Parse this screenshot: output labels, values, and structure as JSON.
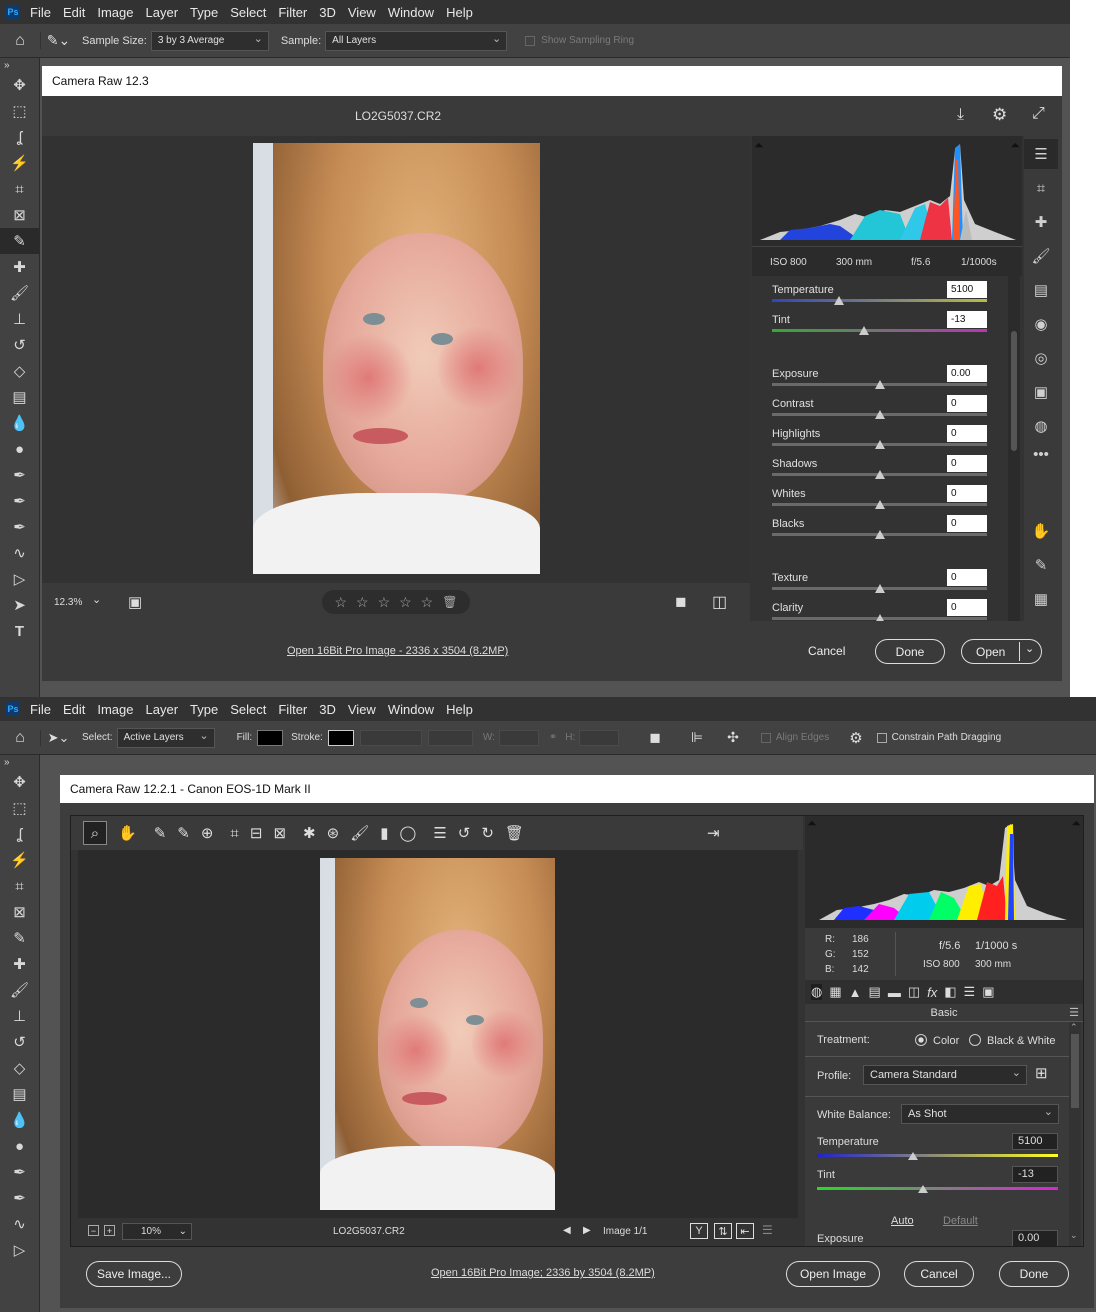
{
  "menu": [
    "File",
    "Edit",
    "Image",
    "Layer",
    "Type",
    "Select",
    "Filter",
    "3D",
    "View",
    "Window",
    "Help"
  ],
  "top": {
    "options": {
      "sample_size_label": "Sample Size:",
      "sample_size_value": "3 by 3 Average",
      "sample_label": "Sample:",
      "sample_value": "All Layers",
      "show_ring": "Show Sampling Ring"
    },
    "dialog_title": "Camera Raw 12.3",
    "filename": "LO2G5037.CR2",
    "meta": {
      "iso": "ISO 800",
      "focal": "300 mm",
      "aperture": "f/5.6",
      "shutter": "1/1000s"
    },
    "sliders": [
      {
        "label": "Temperature",
        "value": "5100",
        "pos": 0.31
      },
      {
        "label": "Tint",
        "value": "-13",
        "pos": 0.43
      },
      {
        "label": "Exposure",
        "value": "0.00",
        "pos": 0.5
      },
      {
        "label": "Contrast",
        "value": "0",
        "pos": 0.5
      },
      {
        "label": "Highlights",
        "value": "0",
        "pos": 0.5
      },
      {
        "label": "Shadows",
        "value": "0",
        "pos": 0.5
      },
      {
        "label": "Whites",
        "value": "0",
        "pos": 0.5
      },
      {
        "label": "Blacks",
        "value": "0",
        "pos": 0.5
      },
      {
        "label": "Texture",
        "value": "0",
        "pos": 0.5
      },
      {
        "label": "Clarity",
        "value": "0",
        "pos": 0.5
      }
    ],
    "zoom": "12.3%",
    "workflow_link": "Open 16Bit Pro Image - 2336 x 3504 (8.2MP)",
    "cancel": "Cancel",
    "done": "Done",
    "open": "Open"
  },
  "bottom": {
    "options": {
      "select_label": "Select:",
      "select_value": "Active Layers",
      "fill_label": "Fill:",
      "stroke_label": "Stroke:",
      "w_label": "W:",
      "h_label": "H:",
      "align_edges": "Align Edges",
      "constrain": "Constrain Path Dragging"
    },
    "dialog_title": "Camera Raw 12.2.1  -  Canon EOS-1D Mark II",
    "rgb": {
      "r_label": "R:",
      "r": "186",
      "g_label": "G:",
      "g": "152",
      "b_label": "B:",
      "b": "142"
    },
    "meta": {
      "aperture": "f/5.6",
      "shutter": "1/1000 s",
      "iso": "ISO 800",
      "focal": "300 mm"
    },
    "panel_title": "Basic",
    "treatment_label": "Treatment:",
    "color": "Color",
    "bw": "Black & White",
    "profile_label": "Profile:",
    "profile_value": "Camera Standard",
    "wb_label": "White Balance:",
    "wb_value": "As Shot",
    "temp_label": "Temperature",
    "temp_value": "5100",
    "temp_pos": 0.4,
    "tint_label": "Tint",
    "tint_value": "-13",
    "tint_pos": 0.44,
    "auto": "Auto",
    "default": "Default",
    "exposure_label": "Exposure",
    "exposure_value": "0.00",
    "zoom": "10%",
    "filename": "LO2G5037.CR2",
    "image_count": "Image 1/1",
    "save": "Save Image...",
    "workflow_link": "Open 16Bit Pro Image; 2336 by 3504 (8.2MP)",
    "open": "Open Image",
    "cancel": "Cancel",
    "done": "Done"
  }
}
